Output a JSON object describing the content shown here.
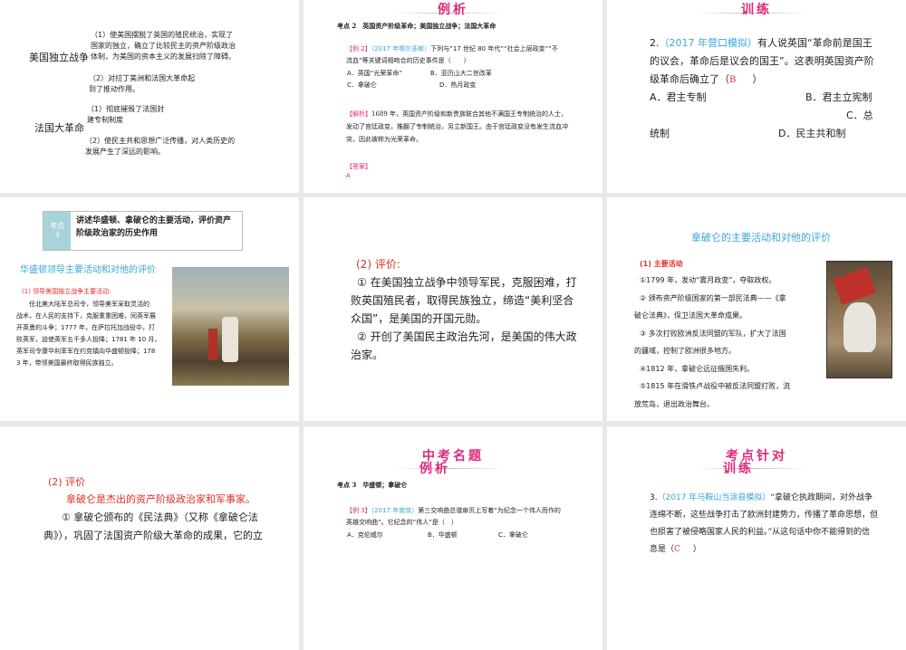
{
  "slides": [
    {
      "war1": "美国独立战争",
      "war1_p1": [
        "（1）使美国摆脱了英国的殖民统治，实现了",
        "国家的独立，确立了比较民主的资产阶级政治",
        "体制，为美国的资本主义的发展扫除了障碍。"
      ],
      "war1_p2": [
        "（2）对拉丁美洲和法国大革命起",
        "到了推动作用。"
      ],
      "war2": "法国大革命",
      "war2_p1": [
        "（1）彻底摧毁了法国封",
        "建专制制度"
      ],
      "war2_p2": [
        "（2）使民主共和思想广泛传播，对人类历史的",
        "发展产生了深远的影响。"
      ]
    },
    {
      "header": "例析",
      "topic": "考点 2　英国资产阶级革命；美国独立战争；法国大革命",
      "ex_label": "【例 2】",
      "ex_source": "（2017 年鄂尔多斯）",
      "ex_text1": "下列与“17 世纪 80 年代”“社会上层政变”“不",
      "ex_text2": "流血”等关键词相吻合的历史事件是（　　）",
      "opt_a": "A．英国“光荣革命”",
      "opt_b": "B．亚历山大二世改革",
      "opt_c": "C．拿破仑",
      "opt_d": "D．热月政变",
      "analysis_label": "【解析】",
      "analysis": [
        "1689 年，英国资产阶级和新贵族联合其他不满国王专制统治的人士，",
        "发动了宫廷政变，推翻了专制统治，另立新国王。由于宫廷政变没有发生流血冲",
        "突，因此被称为光荣革命。"
      ],
      "answer_label": "【答案】",
      "answer": "A"
    },
    {
      "header": "训练",
      "q_num": "2.",
      "q_source": "（2017 年营口模拟）",
      "q_text1": "有人说英国“革命前是国王",
      "q_text2": "的议会，革命后是议会的国王”。这表明英国资产阶",
      "q_text3": "级革命后确立了（",
      "q_answer": "B",
      "q_close": "）",
      "opt_a": "A．君主专制",
      "opt_b": "B．君主立宪制",
      "opt_c": "C．总",
      "opt_c2": "统制",
      "opt_d": "D．民主共和制"
    },
    {
      "box_key": "考点\n3",
      "box_text": "讲述华盛顿、拿破仑的主要活动，评价资产阶级政治家的历史作用",
      "title": "华盛顿领导主要活动和对他的评价",
      "sub": "(1) 领导美国独立战争主要活动:",
      "para": [
        "　　任北美大陆军总司令，领导美军采取灵活的",
        "战术，在人民的支持下，克服重重困难，同英军展",
        "开英勇的斗争；1777 年，在萨拉托加战役中，打",
        "败英军，迫使英军五千多人投降；1781 年 10 月，",
        "英军司令康华利率军在约克镇向华盛顿投降；178",
        "3 年，带领美国最终取得民族独立。"
      ]
    },
    {
      "head": "(2) 评价:",
      "lines": [
        "① 在美国独立战争中领导军民，克服困难，打",
        "败英国殖民者，取得民族独立，缔造“美利坚合",
        "众国”，是美国的开国元勋。",
        "② 开创了美国民主政治先河，是美国的伟大政",
        "治家。"
      ]
    },
    {
      "title": "拿破仑的主要活动和对他的评价",
      "sub": "(1) 主要活动",
      "lines": [
        "①1799 年，发动“雾月政变”，夺取政权。",
        "② 颁布资产阶级国家的第一部民法典——《拿",
        "破仑法典》，保卫法国大革命成果。",
        "③ 多次打败欧洲反法同盟的军队，扩大了法国",
        "的疆域，控制了欧洲很多地方。",
        "④1812 年，拿破仑远征俄国失利。",
        "⑤1815 年在滑铁卢战役中被反法同盟打败，流",
        "放荒岛，退出政治舞台。"
      ]
    },
    {
      "head": "(2) 评价",
      "red": "拿破仑是杰出的资产阶级政治家和军事家。",
      "lines": [
        "① 拿破仑颁布的《民法典》（又称《拿破仑法",
        "典》），巩固了法国资产阶级大革命的成果，它的立"
      ]
    },
    {
      "header1": "中考名题",
      "header2": "例析",
      "topic": "考点 3　华盛顿；拿破仑",
      "ex_label": "【例 3】",
      "ex_source": "（2017 年南京）",
      "ex_text1": "第三交响曲总谱扉页上写着“为纪念一个伟人而作的",
      "ex_text2": "英雄交响曲”。它纪念的“伟人”是（　）",
      "opt_a": "A．克伦威尔",
      "opt_b": "B．华盛顿",
      "opt_c": "C．拿破仑"
    },
    {
      "header1": "考点针对",
      "header2": "训练",
      "q_num": "3.",
      "q_source": "（2017 年马鞍山当涂县模拟）",
      "q_text": [
        "“拿破仑执政期间，对外战争",
        "连绵不断，这些战争打击了欧洲封建势力，传播了革命思想，但",
        "也损害了被侵略国家人民的利益。”从这句话中你不能得到的信",
        "息是（"
      ],
      "q_answer": "C",
      "q_close": "）"
    }
  ]
}
